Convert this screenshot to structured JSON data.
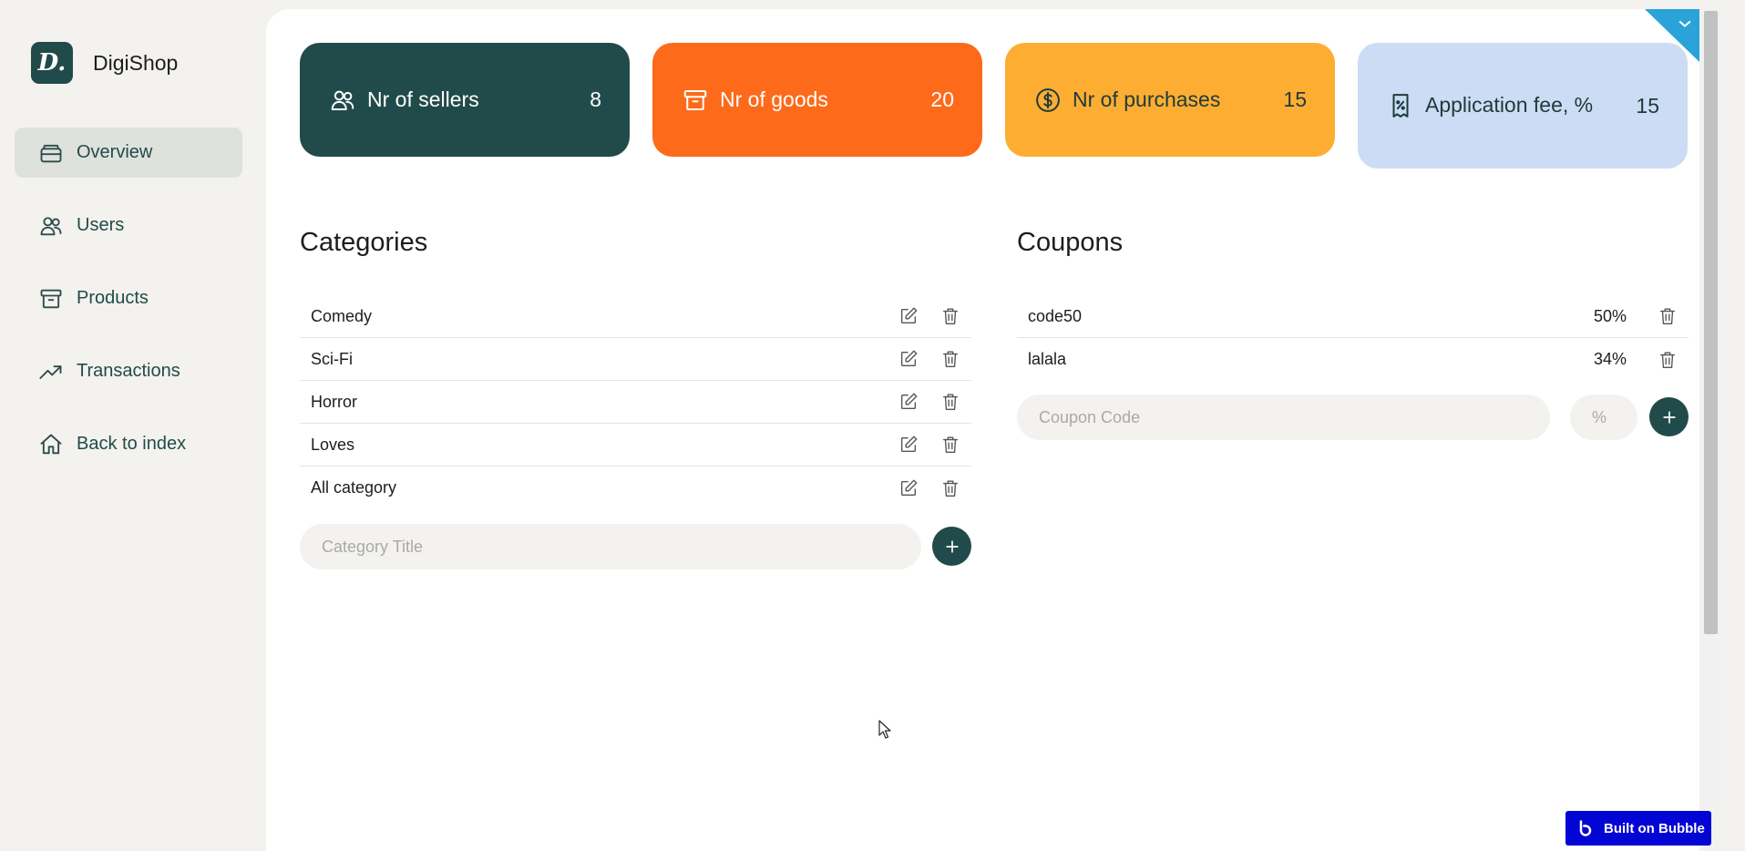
{
  "brand": {
    "logo_text": "D.",
    "name": "DigiShop"
  },
  "sidebar": {
    "items": [
      {
        "label": "Overview",
        "icon": "inbox-icon",
        "active": true
      },
      {
        "label": "Users",
        "icon": "users-icon",
        "active": false
      },
      {
        "label": "Products",
        "icon": "archive-icon",
        "active": false
      },
      {
        "label": "Transactions",
        "icon": "trending-up-icon",
        "active": false
      },
      {
        "label": "Back to index",
        "icon": "home-icon",
        "active": false
      }
    ]
  },
  "stats": [
    {
      "label": "Nr of sellers",
      "value": "8",
      "icon": "users-icon",
      "color": "#214b4a"
    },
    {
      "label": "Nr of goods",
      "value": "20",
      "icon": "archive-icon",
      "color": "#fd6a1a"
    },
    {
      "label": "Nr of purchases",
      "value": "15",
      "icon": "dollar-circle-icon",
      "color": "#fdae32"
    },
    {
      "label": "Application fee, %",
      "value": "15",
      "icon": "receipt-percent-icon",
      "color": "#cbdcf4"
    }
  ],
  "categories": {
    "title": "Categories",
    "items": [
      "Comedy",
      "Sci-Fi",
      "Horror",
      "Loves",
      "All category"
    ],
    "input_placeholder": "Category Title"
  },
  "coupons": {
    "title": "Coupons",
    "items": [
      {
        "code": "code50",
        "percent": "50%"
      },
      {
        "code": "lalala",
        "percent": "34%"
      }
    ],
    "code_placeholder": "Coupon Code",
    "percent_placeholder": "%"
  },
  "badge": {
    "label": "Built on Bubble"
  },
  "colors": {
    "accent": "#214b4a",
    "background": "#f3f2ee"
  }
}
